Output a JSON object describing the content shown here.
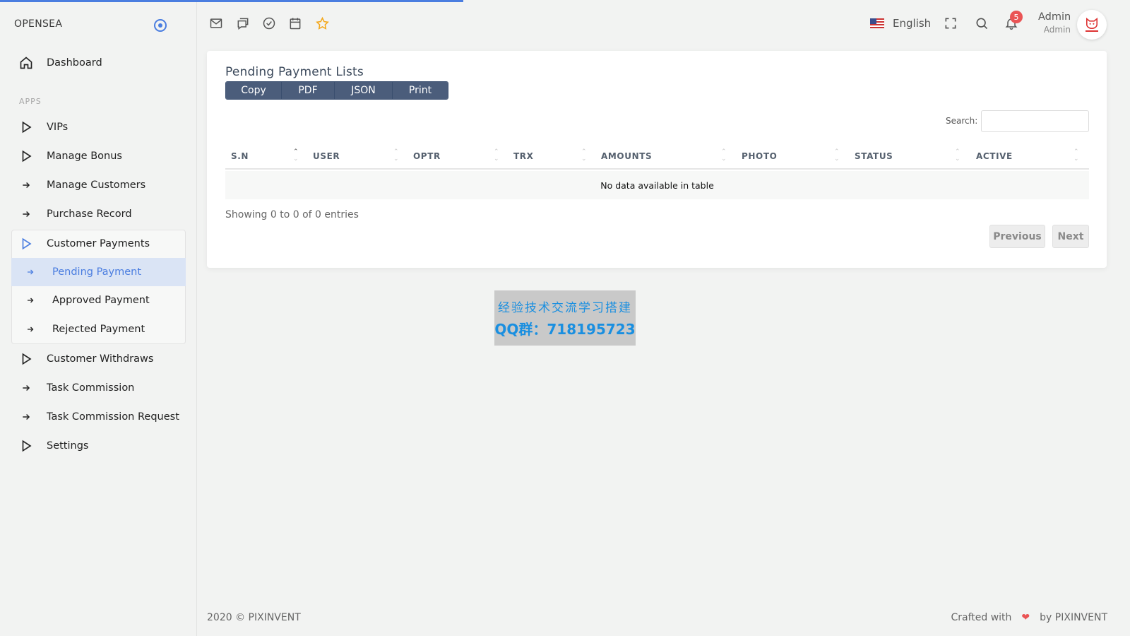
{
  "colors": {
    "accent": "#4a7de0",
    "badge": "#ea5455",
    "button_group": "#4b5d7b"
  },
  "load_progress": 0.41,
  "sidebar": {
    "brand": "OPENSEA",
    "section_label": "APPS",
    "items": [
      {
        "label": "Dashboard",
        "icon": "home-icon"
      },
      {
        "label": "VIPs",
        "icon": "play-outline-icon"
      },
      {
        "label": "Manage Bonus",
        "icon": "play-outline-icon"
      },
      {
        "label": "Manage Customers",
        "icon": "arrow-right-icon"
      },
      {
        "label": "Purchase Record",
        "icon": "arrow-right-icon"
      },
      {
        "label": "Customer Payments",
        "icon": "play-outline-icon"
      },
      {
        "label": "Customer Withdraws",
        "icon": "play-outline-icon"
      },
      {
        "label": "Task Commission",
        "icon": "arrow-right-icon"
      },
      {
        "label": "Task Commission Request",
        "icon": "arrow-right-icon"
      },
      {
        "label": "Settings",
        "icon": "play-outline-icon"
      }
    ],
    "submenu": [
      {
        "label": "Pending Payment",
        "active": true
      },
      {
        "label": "Approved Payment",
        "active": false
      },
      {
        "label": "Rejected Payment",
        "active": false
      }
    ]
  },
  "header": {
    "language": "English",
    "notification_count": "5",
    "user_name": "Admin",
    "user_role": "Admin"
  },
  "main": {
    "title": "Pending Payment Lists",
    "buttons": [
      "Copy",
      "PDF",
      "JSON",
      "Print"
    ],
    "search_label": "Search:",
    "search_value": "",
    "columns": [
      "S.N",
      "USER",
      "OPTR",
      "TRX",
      "AMOUNTS",
      "PHOTO",
      "STATUS",
      "ACTIVE"
    ],
    "empty_message": "No data available in table",
    "info": "Showing 0 to 0 of 0 entries",
    "previous": "Previous",
    "next": "Next"
  },
  "watermark": {
    "line1": "经验技术交流学习搭建",
    "line2": "QQ群：718195723"
  },
  "footer": {
    "copyright": "2020 © PIXINVENT",
    "crafted_prefix": "Crafted with",
    "crafted_suffix": "by PIXINVENT"
  }
}
